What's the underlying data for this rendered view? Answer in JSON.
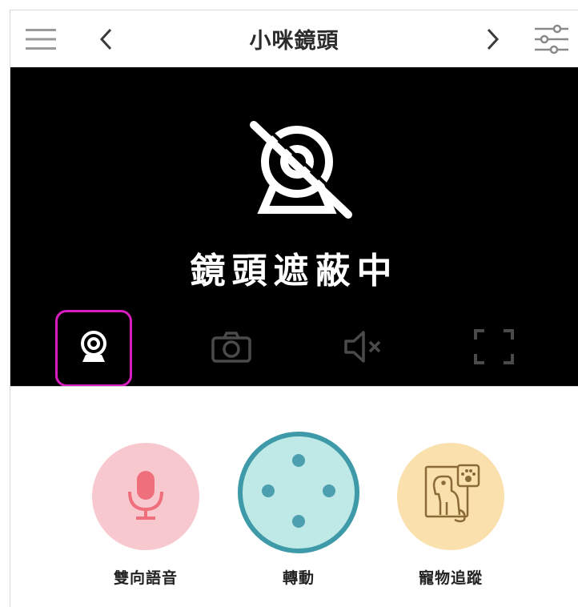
{
  "header": {
    "title": "小咪鏡頭",
    "menu_icon": "hamburger-menu-icon",
    "prev_icon": "chevron-left-icon",
    "next_icon": "chevron-right-icon",
    "settings_icon": "sliders-settings-icon"
  },
  "camera_view": {
    "status_text": "鏡頭遮蔽中",
    "status_icon": "camera-off-icon",
    "controls": [
      {
        "name": "privacy-camera-toggle",
        "icon": "webcam-icon",
        "active": true
      },
      {
        "name": "snapshot",
        "icon": "camera-icon",
        "active": false
      },
      {
        "name": "mute",
        "icon": "speaker-muted-icon",
        "active": false
      },
      {
        "name": "fullscreen",
        "icon": "fullscreen-icon",
        "active": false
      }
    ],
    "active_outline_color": "#d91cbf"
  },
  "actions": [
    {
      "label": "雙向語音",
      "icon": "microphone-icon",
      "color": "#f8c8cf"
    },
    {
      "label": "轉動",
      "icon": "direction-pad-icon",
      "color": "#bfe9e6"
    },
    {
      "label": "寵物追蹤",
      "icon": "pet-tracking-icon",
      "color": "#fae0ad"
    }
  ]
}
